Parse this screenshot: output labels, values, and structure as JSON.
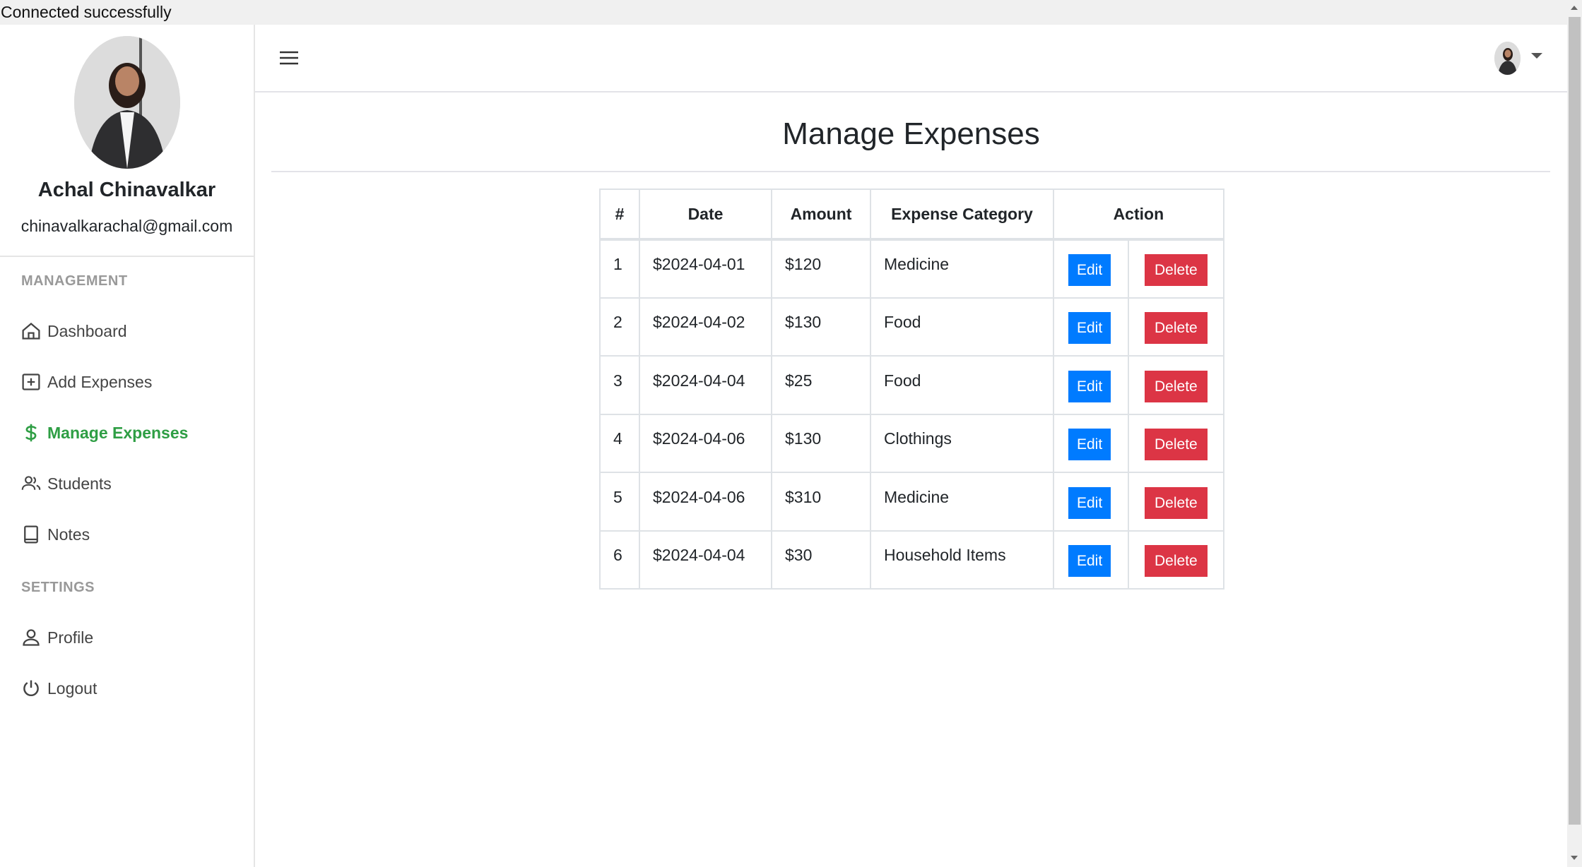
{
  "status_bar": {
    "message": "Connected successfully"
  },
  "user": {
    "name": "Achal Chinavalkar",
    "email": "chinavalkarachal@gmail.com"
  },
  "sidebar": {
    "sections": [
      {
        "label": "MANAGEMENT"
      },
      {
        "label": "SETTINGS"
      }
    ],
    "items": [
      {
        "label": "Dashboard",
        "icon": "house-icon"
      },
      {
        "label": "Add Expenses",
        "icon": "plus-square-icon"
      },
      {
        "label": "Manage Expenses",
        "icon": "dollar-icon",
        "active": true
      },
      {
        "label": "Students",
        "icon": "people-icon"
      },
      {
        "label": "Notes",
        "icon": "book-icon"
      },
      {
        "label": "Profile",
        "icon": "person-icon"
      },
      {
        "label": "Logout",
        "icon": "power-icon"
      }
    ],
    "active_color": "#2e9e44"
  },
  "page": {
    "title": "Manage Expenses"
  },
  "table": {
    "headers": [
      "#",
      "Date",
      "Amount",
      "Expense Category",
      "Action"
    ],
    "edit_label": "Edit",
    "delete_label": "Delete",
    "rows": [
      {
        "n": "1",
        "date": "$2024-04-01",
        "amount": "$120",
        "category": "Medicine"
      },
      {
        "n": "2",
        "date": "$2024-04-02",
        "amount": "$130",
        "category": "Food"
      },
      {
        "n": "3",
        "date": "$2024-04-04",
        "amount": "$25",
        "category": "Food"
      },
      {
        "n": "4",
        "date": "$2024-04-06",
        "amount": "$130",
        "category": "Clothings"
      },
      {
        "n": "5",
        "date": "$2024-04-06",
        "amount": "$310",
        "category": "Medicine"
      },
      {
        "n": "6",
        "date": "$2024-04-04",
        "amount": "$30",
        "category": "Household Items"
      }
    ]
  },
  "colors": {
    "edit": "#007bff",
    "delete": "#dc3545"
  }
}
